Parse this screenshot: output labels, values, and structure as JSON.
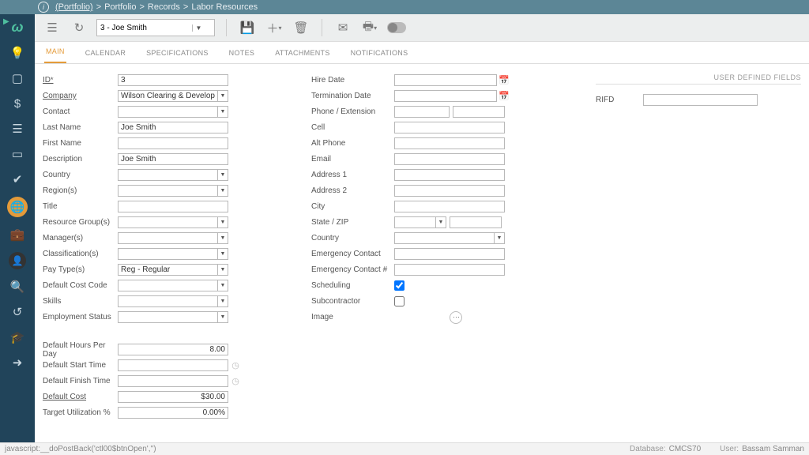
{
  "breadcrumb": {
    "p0": "(Portfolio)",
    "p1": "Portfolio",
    "p2": "Records",
    "p3": "Labor Resources",
    "sep": ">"
  },
  "record_selector": "3 - Joe Smith",
  "tabs": {
    "main": "MAIN",
    "calendar": "CALENDAR",
    "specs": "SPECIFICATIONS",
    "notes": "NOTES",
    "attach": "ATTACHMENTS",
    "notif": "NOTIFICATIONS"
  },
  "c1": {
    "id_lbl": "ID",
    "id_val": "3",
    "company_lbl": "Company",
    "company_val": "Wilson Clearing & Development Inc.",
    "contact_lbl": "Contact",
    "contact_val": "",
    "lastname_lbl": "Last Name",
    "lastname_val": "Joe Smith",
    "firstname_lbl": "First Name",
    "firstname_val": "",
    "desc_lbl": "Description",
    "desc_val": "Joe Smith",
    "country_lbl": "Country",
    "country_val": "",
    "regions_lbl": "Region(s)",
    "regions_val": "",
    "title_lbl": "Title",
    "title_val": "",
    "resgrp_lbl": "Resource Group(s)",
    "resgrp_val": "",
    "managers_lbl": "Manager(s)",
    "managers_val": "",
    "class_lbl": "Classification(s)",
    "class_val": "",
    "paytype_lbl": "Pay Type(s)",
    "paytype_val": "Reg - Regular",
    "defcc_lbl": "Default Cost Code",
    "defcc_val": "",
    "skills_lbl": "Skills",
    "skills_val": "",
    "empst_lbl": "Employment Status",
    "empst_val": "",
    "dhpd_lbl": "Default Hours Per Day",
    "dhpd_val": "8.00",
    "dst_lbl": "Default Start Time",
    "dst_val": "",
    "dft_lbl": "Default Finish Time",
    "dft_val": "",
    "dcost_lbl": "Default Cost",
    "dcost_val": "$30.00",
    "tutil_lbl": "Target Utilization %",
    "tutil_val": "0.00%"
  },
  "c2": {
    "hire_lbl": "Hire Date",
    "term_lbl": "Termination Date",
    "phone_lbl": "Phone / Extension",
    "cell_lbl": "Cell",
    "altp_lbl": "Alt Phone",
    "email_lbl": "Email",
    "addr1_lbl": "Address 1",
    "addr2_lbl": "Address 2",
    "city_lbl": "City",
    "szip_lbl": "State / ZIP",
    "country_lbl": "Country",
    "emc_lbl": "Emergency Contact",
    "emcn_lbl": "Emergency Contact #",
    "sched_lbl": "Scheduling",
    "sub_lbl": "Subcontractor",
    "img_lbl": "Image"
  },
  "c3": {
    "section": "USER DEFINED FIELDS",
    "rifd_lbl": "RIFD",
    "rifd_val": ""
  },
  "status": {
    "js": "javascript:__doPostBack('ctl00$btnOpen','')",
    "db_k": "Database:",
    "db_v": "CMCS70",
    "user_k": "User:",
    "user_v": "Bassam Samman"
  }
}
